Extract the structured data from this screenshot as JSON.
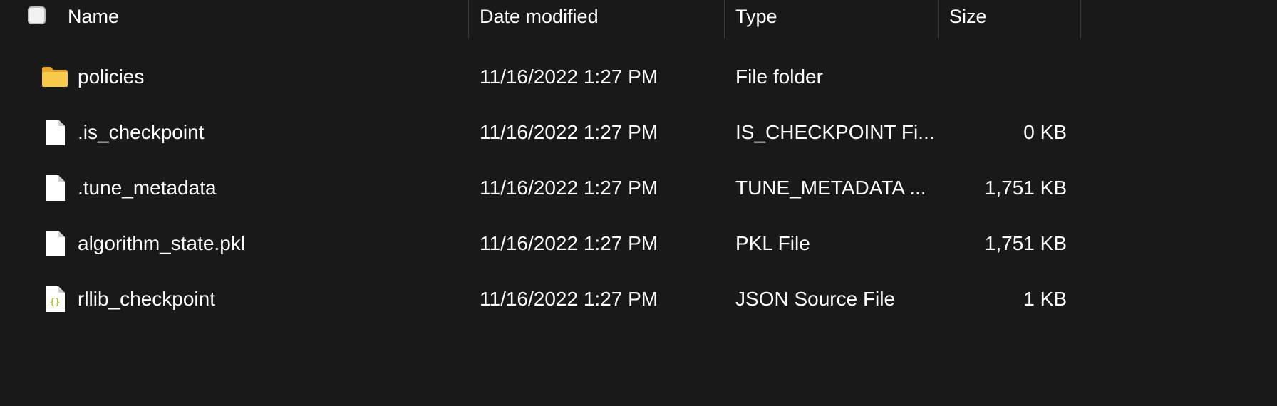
{
  "header": {
    "name_label": "Name",
    "date_label": "Date modified",
    "type_label": "Type",
    "size_label": "Size"
  },
  "files": [
    {
      "icon": "folder-icon",
      "name": "policies",
      "date": "11/16/2022 1:27 PM",
      "type": "File folder",
      "size": ""
    },
    {
      "icon": "file-icon",
      "name": ".is_checkpoint",
      "date": "11/16/2022 1:27 PM",
      "type": "IS_CHECKPOINT Fi...",
      "size": "0 KB"
    },
    {
      "icon": "file-icon",
      "name": ".tune_metadata",
      "date": "11/16/2022 1:27 PM",
      "type": "TUNE_METADATA ...",
      "size": "1,751 KB"
    },
    {
      "icon": "file-icon",
      "name": "algorithm_state.pkl",
      "date": "11/16/2022 1:27 PM",
      "type": "PKL File",
      "size": "1,751 KB"
    },
    {
      "icon": "json-file-icon",
      "name": "rllib_checkpoint",
      "date": "11/16/2022 1:27 PM",
      "type": "JSON Source File",
      "size": "1 KB"
    }
  ],
  "colors": {
    "background": "#191919",
    "folder": "#f8c94a",
    "json_braces": "#c8d03a"
  }
}
